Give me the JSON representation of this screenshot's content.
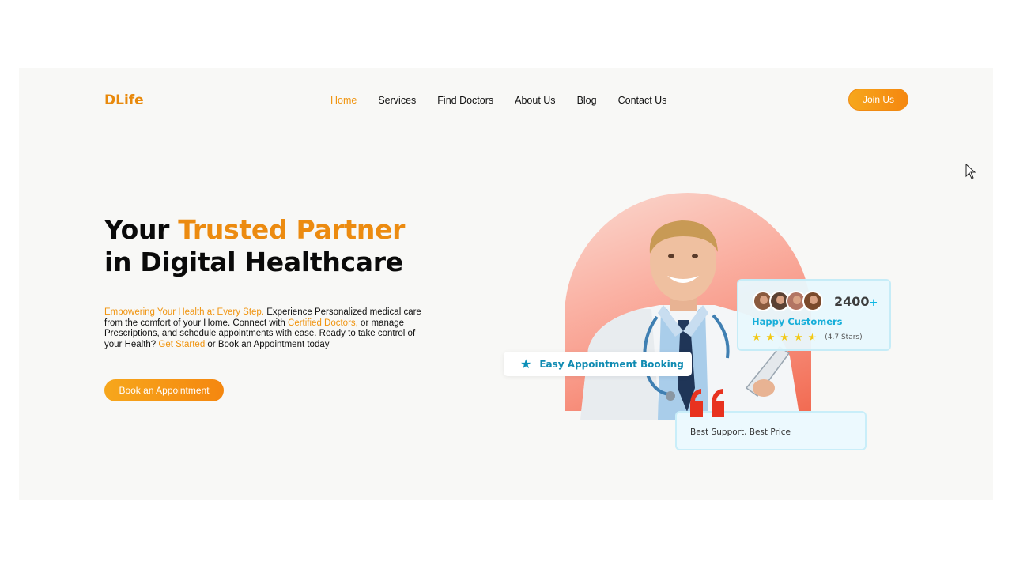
{
  "header": {
    "logo": "DLife",
    "nav": [
      "Home",
      "Services",
      "Find Doctors",
      "About Us",
      "Blog",
      "Contact Us"
    ],
    "active_nav": "Home",
    "join_label": "Join Us"
  },
  "hero": {
    "title_line1_pre": "Your ",
    "title_line1_highlight": "Trusted Partner",
    "title_line2": "in Digital Healthcare",
    "para_highlight1": "Empowering Your Health at Every Step.",
    "para_text1": " Experience Personalized medical care from the comfort of your Home. Connect with ",
    "para_highlight2": "Certified Doctors,",
    "para_text2": " or manage Prescriptions, and schedule appointments with ease. Ready to take control of your Health? ",
    "para_highlight3": "Get Started",
    "para_text3": " or Book an Appointment today",
    "cta_label": "Book an Appointment"
  },
  "stats_card": {
    "count": "2400",
    "count_suffix": "+",
    "label": "Happy Customers",
    "rating": 4.5,
    "rating_text": "(4.7 Stars)"
  },
  "appointment_card": {
    "label": "Easy Appointment Booking",
    "icon": "star-icon"
  },
  "support_card": {
    "label": "Best Support, Best Price",
    "icon": "quote-icon"
  },
  "colors": {
    "accent": "#f0940f",
    "teal": "#17aed9",
    "arch": "#f9a191"
  }
}
